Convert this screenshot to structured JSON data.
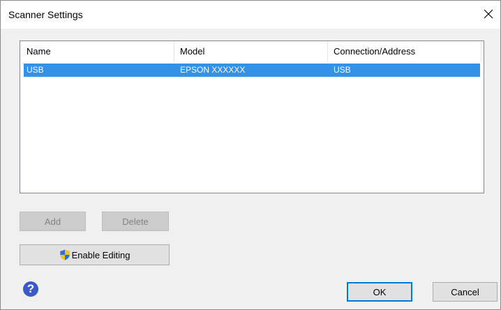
{
  "window": {
    "title": "Scanner Settings"
  },
  "list": {
    "columns": [
      "Name",
      "Model",
      "Connection/Address"
    ],
    "rows": [
      {
        "name": "USB",
        "model": "EPSON XXXXXX",
        "connection": "USB",
        "selected": true
      }
    ]
  },
  "buttons": {
    "add": "Add",
    "delete": "Delete",
    "enable_editing": "Enable Editing",
    "ok": "OK",
    "cancel": "Cancel"
  },
  "icons": {
    "close": "close-icon",
    "shield": "uac-shield-icon",
    "help": "help-icon"
  },
  "colors": {
    "selection": "#3391e8",
    "help": "#3b59c7"
  }
}
